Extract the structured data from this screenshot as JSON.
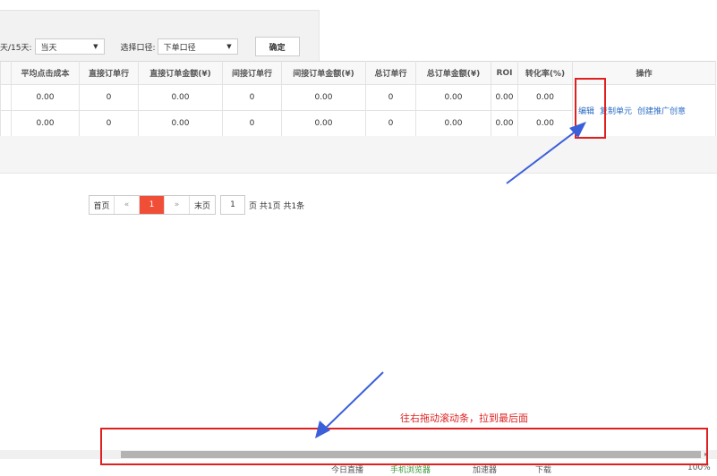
{
  "filter": {
    "range_label": "天/15天:",
    "range_value": "当天",
    "scope_label": "选择口径:",
    "scope_value": "下单口径",
    "confirm_label": "确定"
  },
  "table": {
    "headers": [
      "平均点击成本",
      "直接订单行",
      "直接订单金额(¥)",
      "间接订单行",
      "间接订单金额(¥)",
      "总订单行",
      "总订单金额(¥)",
      "ROI",
      "转化率(%)",
      "操作"
    ],
    "rows": [
      [
        "0.00",
        "0",
        "0.00",
        "0",
        "0.00",
        "0",
        "0.00",
        "0.00",
        "0.00"
      ],
      [
        "0.00",
        "0",
        "0.00",
        "0",
        "0.00",
        "0",
        "0.00",
        "0.00",
        "0.00"
      ]
    ],
    "actions": {
      "edit": "编辑",
      "copy": "复制单元",
      "create": "创建推广创意"
    }
  },
  "pager": {
    "first": "首页",
    "prev": "«",
    "current": "1",
    "next": "»",
    "last": "末页",
    "input_value": "1",
    "summary": "页 共1页 共1条"
  },
  "annotation": {
    "caption": "往右拖动滚动条，拉到最后面",
    "color": "#e02020",
    "arrow_color": "#3a5fd9"
  },
  "statusbar": {
    "items": [
      "今日直播",
      "手机浏览器",
      "加速器",
      "下载",
      "100%"
    ]
  }
}
